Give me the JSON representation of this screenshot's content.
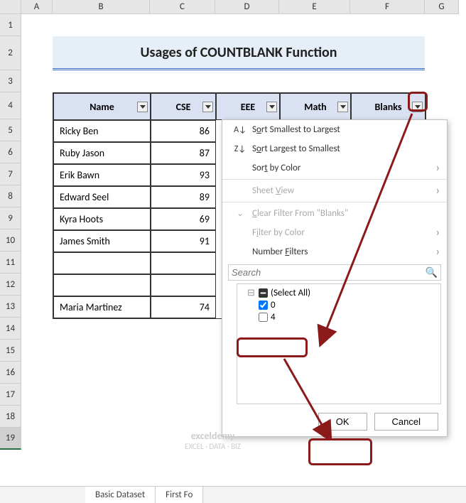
{
  "title": "Usages of COUNTBLANK Function",
  "columns": {
    "A": "A",
    "B": "B",
    "C": "C",
    "D": "D",
    "E": "E",
    "F": "F",
    "G": "G"
  },
  "rows": [
    "1",
    "2",
    "3",
    "4",
    "5",
    "6",
    "7",
    "8",
    "9",
    "10",
    "11",
    "12",
    "13",
    "14",
    "15",
    "16",
    "17",
    "18",
    "19"
  ],
  "headers": {
    "name": "Name",
    "cse": "CSE",
    "eee": "EEE",
    "math": "Math",
    "blanks": "Blanks"
  },
  "data": [
    {
      "name": "Ricky Ben",
      "cse": "86"
    },
    {
      "name": "Ruby Jason",
      "cse": "87"
    },
    {
      "name": "Erik Bawn",
      "cse": "93"
    },
    {
      "name": "Edward Seel",
      "cse": "89"
    },
    {
      "name": "Kyra Hoots",
      "cse": "69"
    },
    {
      "name": "James Smith",
      "cse": "91"
    },
    {
      "name": "",
      "cse": ""
    },
    {
      "name": "",
      "cse": ""
    },
    {
      "name": "Maria Martinez",
      "cse": "74"
    }
  ],
  "dropdown": {
    "sort_asc": "Sort Smallest to Largest",
    "sort_desc": "Sort Largest to Smallest",
    "sort_color": "Sort by Color",
    "sheet_view": "Sheet View",
    "clear_filter": "Clear Filter From \"Blanks\"",
    "filter_color": "Filter by Color",
    "number_filters": "Number Filters",
    "search_placeholder": "Search",
    "select_all": "(Select All)",
    "opt0": "0",
    "opt4": "4",
    "ok": "OK",
    "cancel": "Cancel"
  },
  "tabs": {
    "t1": "Basic Dataset",
    "t2": "First Fo"
  },
  "watermark": {
    "name": "exceldemy",
    "sub": "EXCEL · DATA · BIZ"
  }
}
